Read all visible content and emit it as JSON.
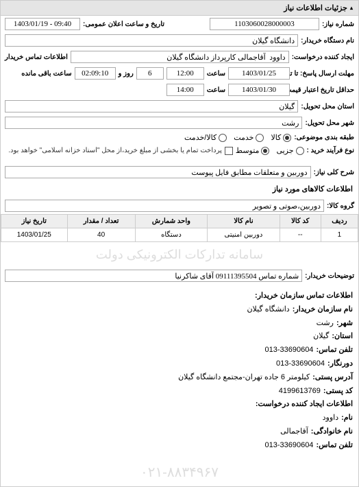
{
  "panel_title": "جزئیات اطلاعات نیاز",
  "fields": {
    "request_no_label": "شماره نیاز:",
    "request_no": "1103060028000003",
    "public_announce_label": "تاریخ و ساعت اعلان عمومی:",
    "public_announce": "1403/01/19 - 09:40",
    "buyer_org_label": "نام دستگاه خریدار:",
    "buyer_org": "دانشگاه گیلان",
    "creator_label": "ایجاد کننده درخواست:",
    "creator": "داوود  آقاجمالی کارپرداز دانشگاه گیلان",
    "buyer_contact_label": "اطلاعات تماس خریدار",
    "deadline_label": "مهلت ارسال پاسخ: تا تاریخ:",
    "deadline_date": "1403/01/25",
    "time_label": "ساعت",
    "deadline_time": "12:00",
    "day_label": "روز و",
    "days_remain": "6",
    "remain_label": "ساعت باقی مانده",
    "remain_time": "02:09:10",
    "validity_label": "حداقل تاریخ اعتبار قیمت: تا تاریخ:",
    "validity_date": "1403/01/30",
    "validity_time": "14:00",
    "province_label": "استان محل تحویل:",
    "province": "گیلان",
    "city_label": "شهر محل تحویل:",
    "city": "رشت",
    "subject_type_label": "طبقه بندی موضوعی:",
    "subject_kala": "کالا",
    "subject_khedmat": "خدمت",
    "subject_kalakhedmat": "کالا/خدمت",
    "process_label": "نوع فرآیند خرید :",
    "process_small": "جزیی",
    "process_medium": "متوسط",
    "pay_note": "پرداخت تمام یا بخشی از مبلغ خرید،از محل \"اسناد خزانه اسلامی\" خواهد بود.",
    "desc_label": "شرح کلی نیاز:",
    "desc": "دوربین و متعلقات مطابق فایل پیوست",
    "items_title": "اطلاعات کالاهای مورد نیاز",
    "group_label": "گروه کالا:",
    "group": "دوربین،صوتی و تصویر",
    "buyer_notes_label": "توضیحات خریدار:",
    "buyer_notes": "شماره تماس 09111395504 آقای شاکرنیا"
  },
  "table": {
    "headers": [
      "ردیف",
      "کد کالا",
      "نام کالا",
      "واحد شمارش",
      "تعداد / مقدار",
      "تاریخ نیاز"
    ],
    "rows": [
      [
        "1",
        "--",
        "دوربین امنیتی",
        "دستگاه",
        "40",
        "1403/01/25"
      ]
    ]
  },
  "watermark": "سامانه تدارکات الکترونیکی دولت",
  "contact_info": {
    "title": "اطلاعات تماس سازمان خریدار:",
    "org_label": "نام سازمان خریدار:",
    "org": "دانشگاه گیلان",
    "city_label": "شهر:",
    "city": "رشت",
    "province_label": "استان:",
    "province": "گیلان",
    "phone_label": "تلفن تماس:",
    "phone": "013-33690604",
    "fax_label": "دورنگار:",
    "fax": "013-33690604",
    "address_label": "آدرس پستی:",
    "address": "کیلومتر 6 جاده تهران-مجتمع دانشگاه گیلان",
    "postcode_label": "کد پستی:",
    "postcode": "4199613769",
    "creator_title": "اطلاعات ایجاد کننده درخواست:",
    "fname_label": "نام:",
    "fname": "داوود",
    "lname_label": "نام خانوادگی:",
    "lname": "آقاجمالی",
    "cphone_label": "تلفن تماس:",
    "cphone": "013-33690604"
  },
  "footer_phone": "۰۲۱-۸۸۳۴۹۶۷"
}
